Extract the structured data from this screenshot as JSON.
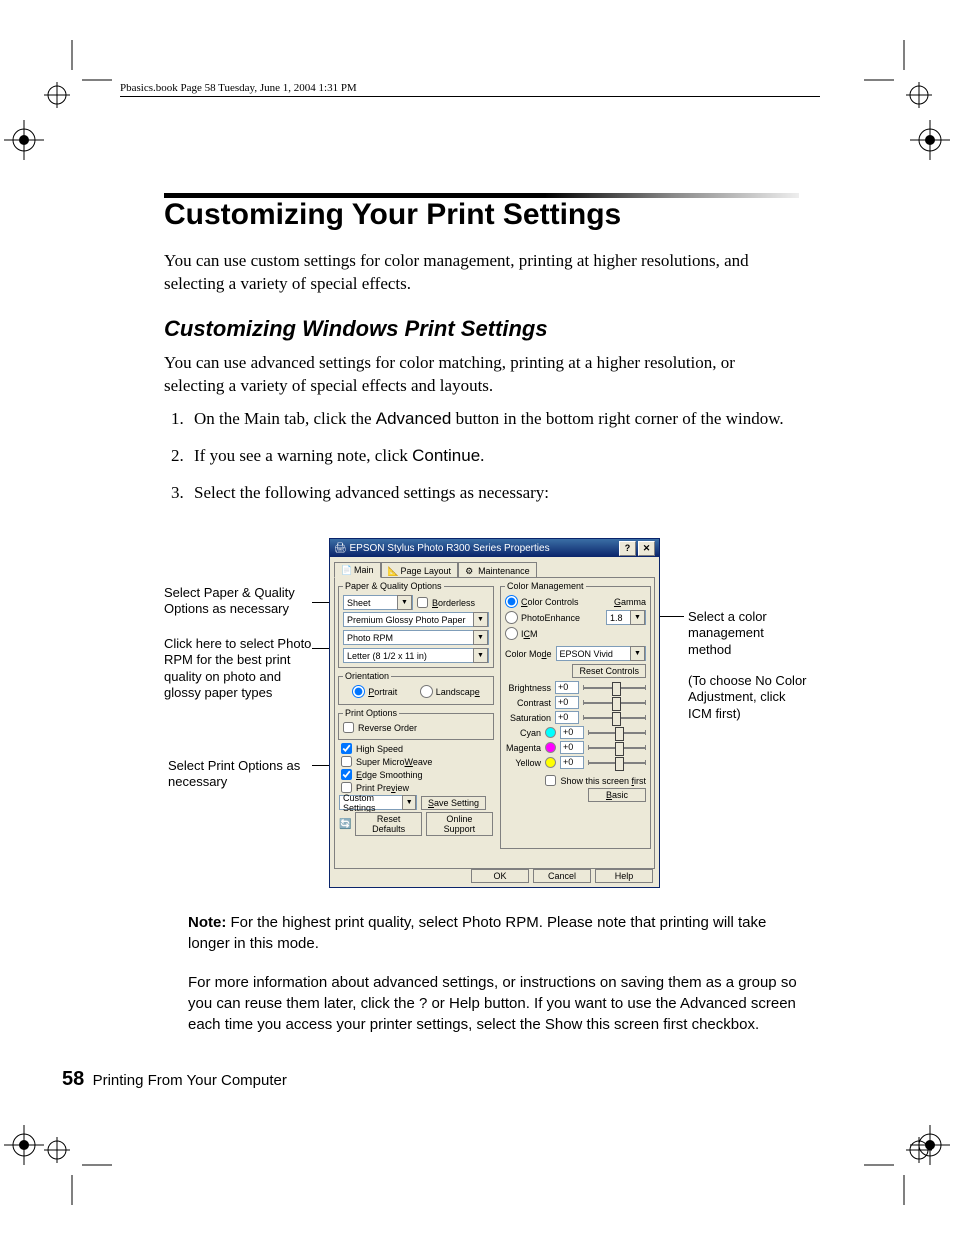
{
  "running_header": "Pbasics.book  Page 58  Tuesday, June 1, 2004  1:31 PM",
  "heading": "Customizing Your Print Settings",
  "intro": "You can use custom settings for color management, printing at higher resolutions, and selecting a variety of special effects.",
  "subheading": "Customizing Windows Print Settings",
  "sub_intro": "You can use advanced settings for color matching, printing at a higher resolution, or selecting a variety of special effects and layouts.",
  "steps": {
    "s1a": "On the Main tab, click the ",
    "s1b": "Advanced",
    "s1c": " button in the bottom right corner of the window.",
    "s2a": "If you see a warning note, click ",
    "s2b": "Continue",
    "s2c": ".",
    "s3": "Select the following advanced settings as necessary:"
  },
  "annotations": {
    "a1": "Select Paper & Quality Options as necessary",
    "a2": "Click here to select Photo RPM for the best print quality on photo and glossy paper types",
    "a3": "Select Print Options as necessary",
    "r1": "Select a color management method",
    "r2": "(To choose No Color Adjustment, click ICM first)"
  },
  "dialog": {
    "title": "EPSON Stylus Photo R300 Series Properties",
    "tabs": {
      "main": "Main",
      "layout": "Page Layout",
      "maint": "Maintenance"
    },
    "paper_quality_legend": "Paper & Quality Options",
    "source": "Sheet",
    "borderless": "Borderless",
    "paper_type": "Premium Glossy Photo Paper",
    "quality": "Photo RPM",
    "size": "Letter (8 1/2 x 11 in)",
    "orientation_legend": "Orientation",
    "portrait": "Portrait",
    "landscape": "Landscape",
    "print_options_legend": "Print Options",
    "reverse": "Reverse Order",
    "high_speed": "High Speed",
    "microweave": "Super MicroWeave",
    "edge": "Edge Smoothing",
    "preview": "Print Preview",
    "custom_settings": "Custom Settings",
    "save_setting": "Save Setting",
    "reset_defaults": "Reset Defaults",
    "online_support": "Online Support",
    "cm_legend": "Color Management",
    "color_controls": "Color Controls",
    "photoenhance": "PhotoEnhance",
    "icm": "ICM",
    "gamma": "Gamma",
    "gamma_val": "1.8",
    "color_mode": "Color Mode",
    "color_mode_val": "EPSON Vivid",
    "reset_controls": "Reset Controls",
    "brightness": "Brightness",
    "contrast": "Contrast",
    "saturation": "Saturation",
    "cyan": "Cyan",
    "magenta": "Magenta",
    "yellow": "Yellow",
    "val0": "+0",
    "show_first": "Show this screen first",
    "basic": "Basic",
    "ok": "OK",
    "cancel": "Cancel",
    "help": "Help"
  },
  "note": {
    "label": "Note:",
    "n1a": " For the highest print quality, select ",
    "n1b": "Photo RPM",
    "n1c": ". Please note that printing will take longer in this mode.",
    "n2a": "For more information about advanced settings, or instructions on saving them as a group so you can reuse them later, click the ",
    "n2b": "?",
    "n2c": " or ",
    "n2d": "Help",
    "n2e": " button. If you want to use the Advanced screen each time you access your printer settings, select the ",
    "n2f": "Show this screen first",
    "n2g": " checkbox."
  },
  "footer": {
    "num": "58",
    "section": "Printing From Your Computer"
  }
}
